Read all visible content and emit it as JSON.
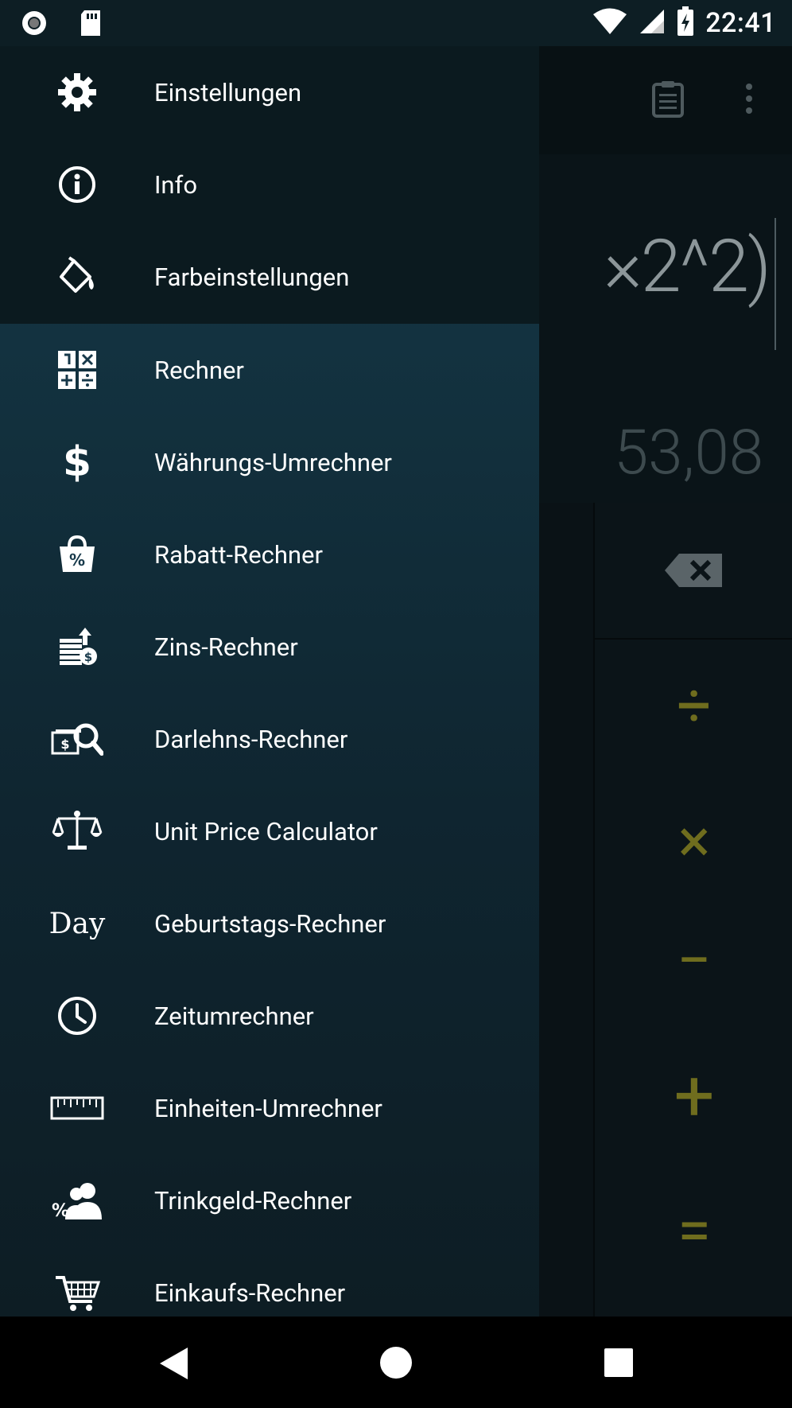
{
  "status_bar": {
    "time": "22:41",
    "left_icons": [
      "record-icon",
      "sd-card-icon"
    ],
    "right_icons": [
      "wifi-icon",
      "signal-icon",
      "battery-charging-icon"
    ]
  },
  "calculator": {
    "expression": "×2^2)",
    "result": "53,08",
    "toolbar_icons": [
      "clipboard-icon",
      "overflow-menu-icon"
    ],
    "operators": [
      "÷",
      "×",
      "−",
      "+",
      "="
    ],
    "operator_color": "#6f6d1e"
  },
  "drawer": {
    "settings_items": [
      {
        "label": "Einstellungen",
        "icon": "gear-icon"
      },
      {
        "label": "Info",
        "icon": "info-icon"
      },
      {
        "label": "Farbeinstellungen",
        "icon": "paint-bucket-icon"
      }
    ],
    "tool_items": [
      {
        "label": "Rechner",
        "icon": "calculator-icon"
      },
      {
        "label": "Währungs-Umrechner",
        "icon": "dollar-icon"
      },
      {
        "label": "Rabatt-Rechner",
        "icon": "discount-bag-icon"
      },
      {
        "label": "Zins-Rechner",
        "icon": "interest-coins-icon"
      },
      {
        "label": "Darlehns-Rechner",
        "icon": "loan-search-icon"
      },
      {
        "label": "Unit Price Calculator",
        "icon": "balance-scale-icon"
      },
      {
        "label": "Geburtstags-Rechner",
        "icon": "day-icon",
        "icon_text": "Day"
      },
      {
        "label": "Zeitumrechner",
        "icon": "clock-icon"
      },
      {
        "label": "Einheiten-Umrechner",
        "icon": "ruler-icon"
      },
      {
        "label": "Trinkgeld-Rechner",
        "icon": "tip-people-icon"
      },
      {
        "label": "Einkaufs-Rechner",
        "icon": "shopping-cart-icon"
      }
    ]
  },
  "nav_bar": {
    "buttons": [
      "back-icon",
      "home-icon",
      "recents-icon"
    ]
  }
}
